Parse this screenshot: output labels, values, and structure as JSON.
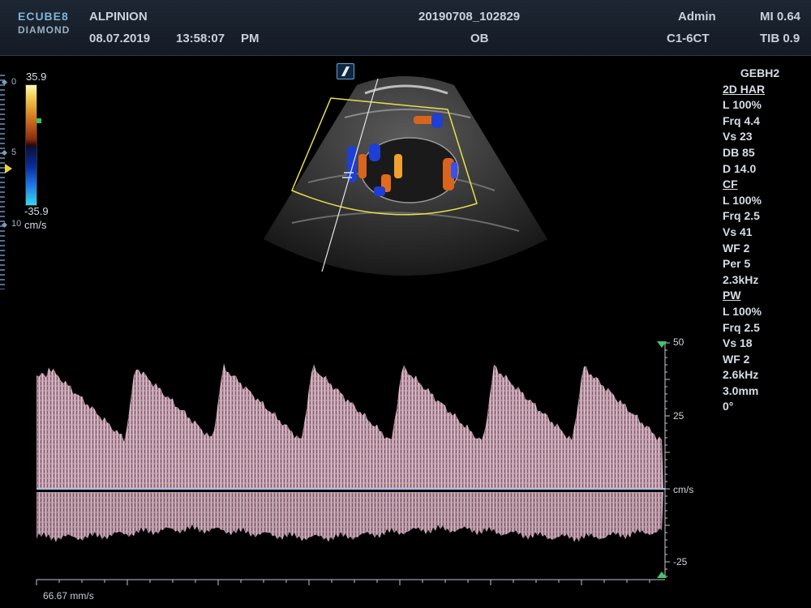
{
  "header": {
    "logo_line1": "ECUBE8",
    "logo_line2": "DIAMOND",
    "brand": "ALPINION",
    "date": "08.07.2019",
    "time": "13:58:07",
    "ampm": "PM",
    "study_id": "20190708_102829",
    "application": "OB",
    "user": "Admin",
    "probe": "C1-6CT",
    "mi": "MI 0.64",
    "tib": "TIB 0.9"
  },
  "depth_ruler": {
    "mark_0": "0",
    "mark_5": "5",
    "mark_10": "10"
  },
  "color_scale": {
    "max": "35.9",
    "min": "-35.9",
    "unit": "cm/s"
  },
  "params": {
    "preset": "GEBH2",
    "twod": {
      "title": "2D HAR",
      "items": [
        "L 100%",
        "Frq 4.4",
        "Vs 23",
        "DB 85",
        "D 14.0"
      ]
    },
    "cf": {
      "title": "CF",
      "items": [
        "L 100%",
        "Frq 2.5",
        "Vs 41",
        "WF 2",
        "Per 5",
        "2.3kHz"
      ]
    },
    "pw": {
      "title": "PW",
      "items": [
        "L 100%",
        "Frq 2.5",
        "Vs 18",
        "WF 2",
        "2.6kHz",
        "3.0mm",
        "0°"
      ]
    }
  },
  "doppler_scale": {
    "top": "50",
    "mid": "25",
    "unit": "cm/s",
    "bottom": "-25"
  },
  "sweep_speed": "66.67 mm/s",
  "colors": {
    "header_bg": "#1d2633",
    "spectrum": "#c7a3b3",
    "baseline": "#a8c0e0",
    "roi": "#e8e04a",
    "marker": "#45c46a"
  }
}
